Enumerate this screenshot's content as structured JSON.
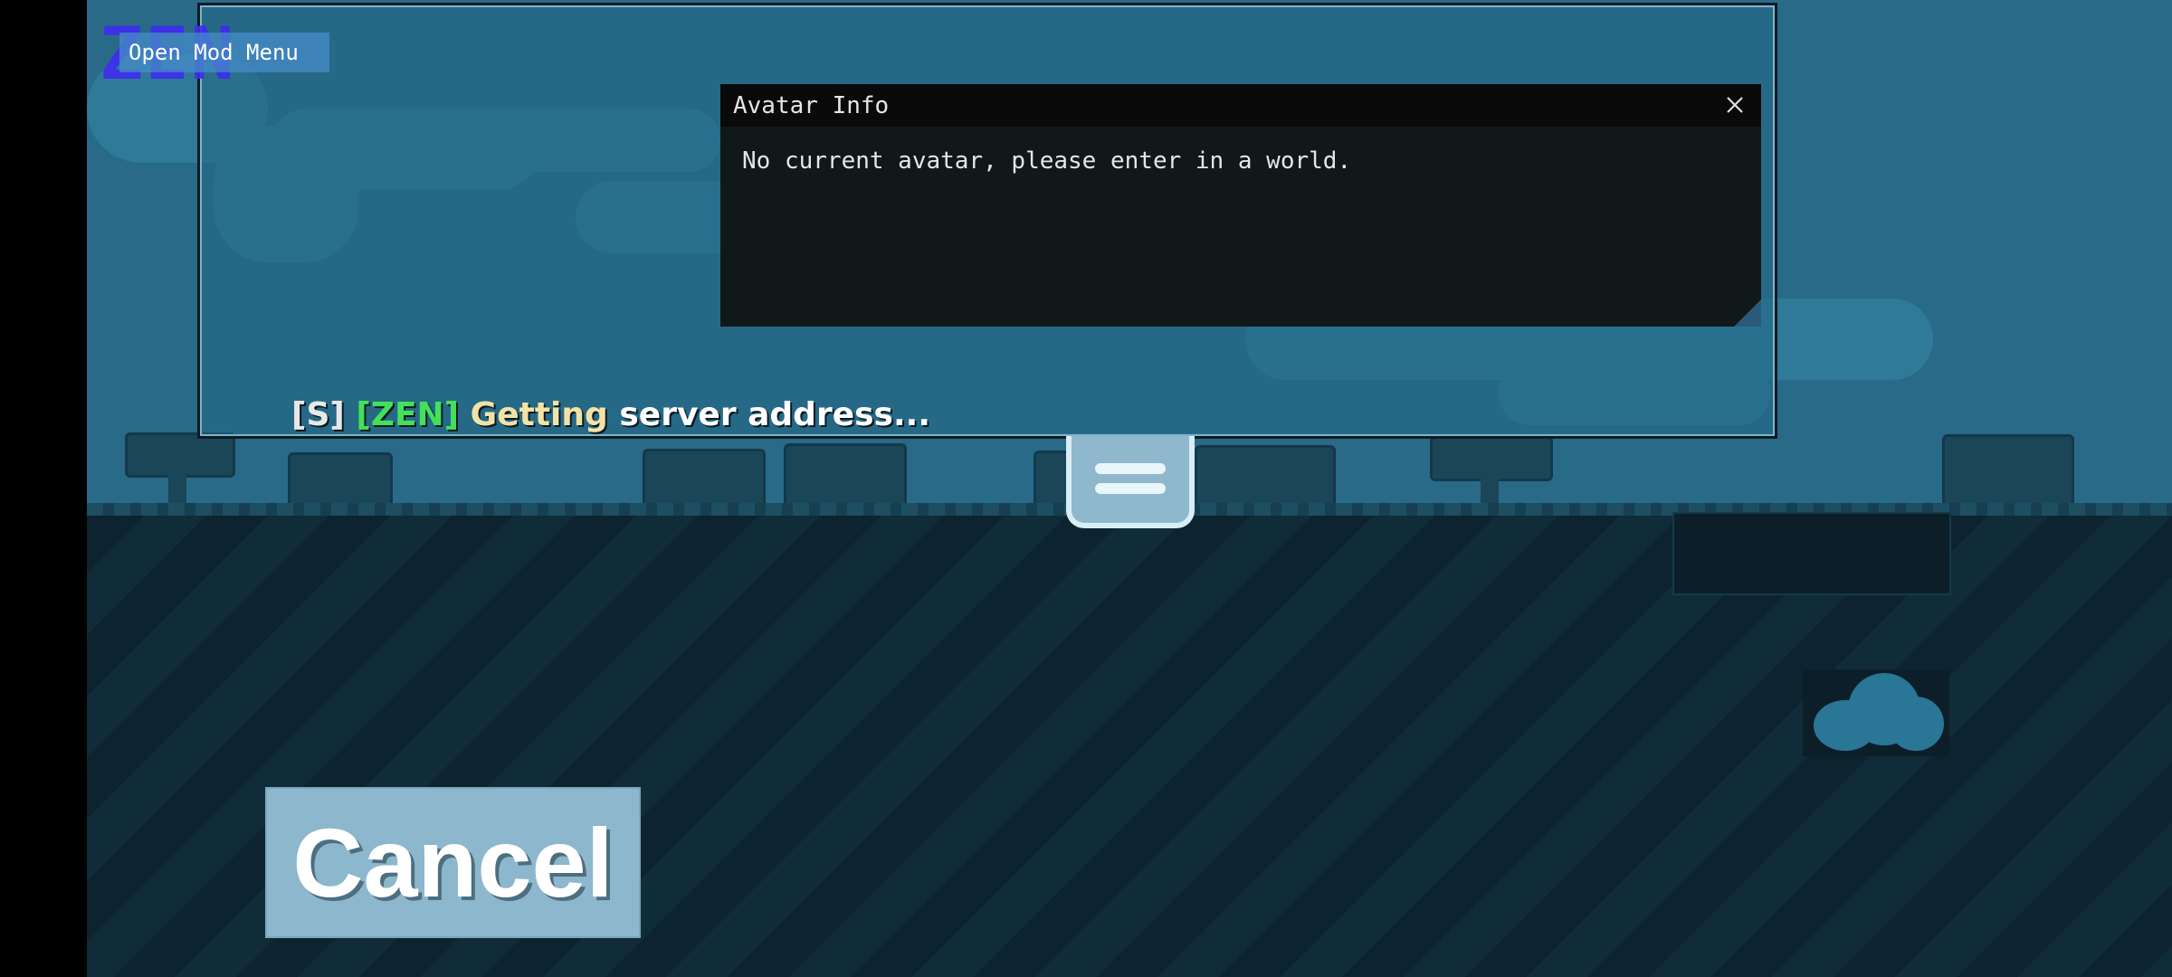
{
  "mod_menu": {
    "logo_text": "ZEN",
    "button_label": "Open Mod Menu"
  },
  "console": {
    "prefix": "[S]",
    "tag": "[ZEN]",
    "highlight": "Getting",
    "message": "server address..."
  },
  "avatar_window": {
    "title": "Avatar Info",
    "message": "No current avatar, please enter in a world.",
    "close_icon": "close-icon"
  },
  "chat_toggle": {
    "icon": "menu-icon"
  },
  "cancel": {
    "label": "Cancel"
  },
  "colors": {
    "tag_green": "#44e05a",
    "highlight_yellow": "#f3e2a6",
    "cancel_bg": "#8cb7cc",
    "window_bg": "#111819"
  }
}
